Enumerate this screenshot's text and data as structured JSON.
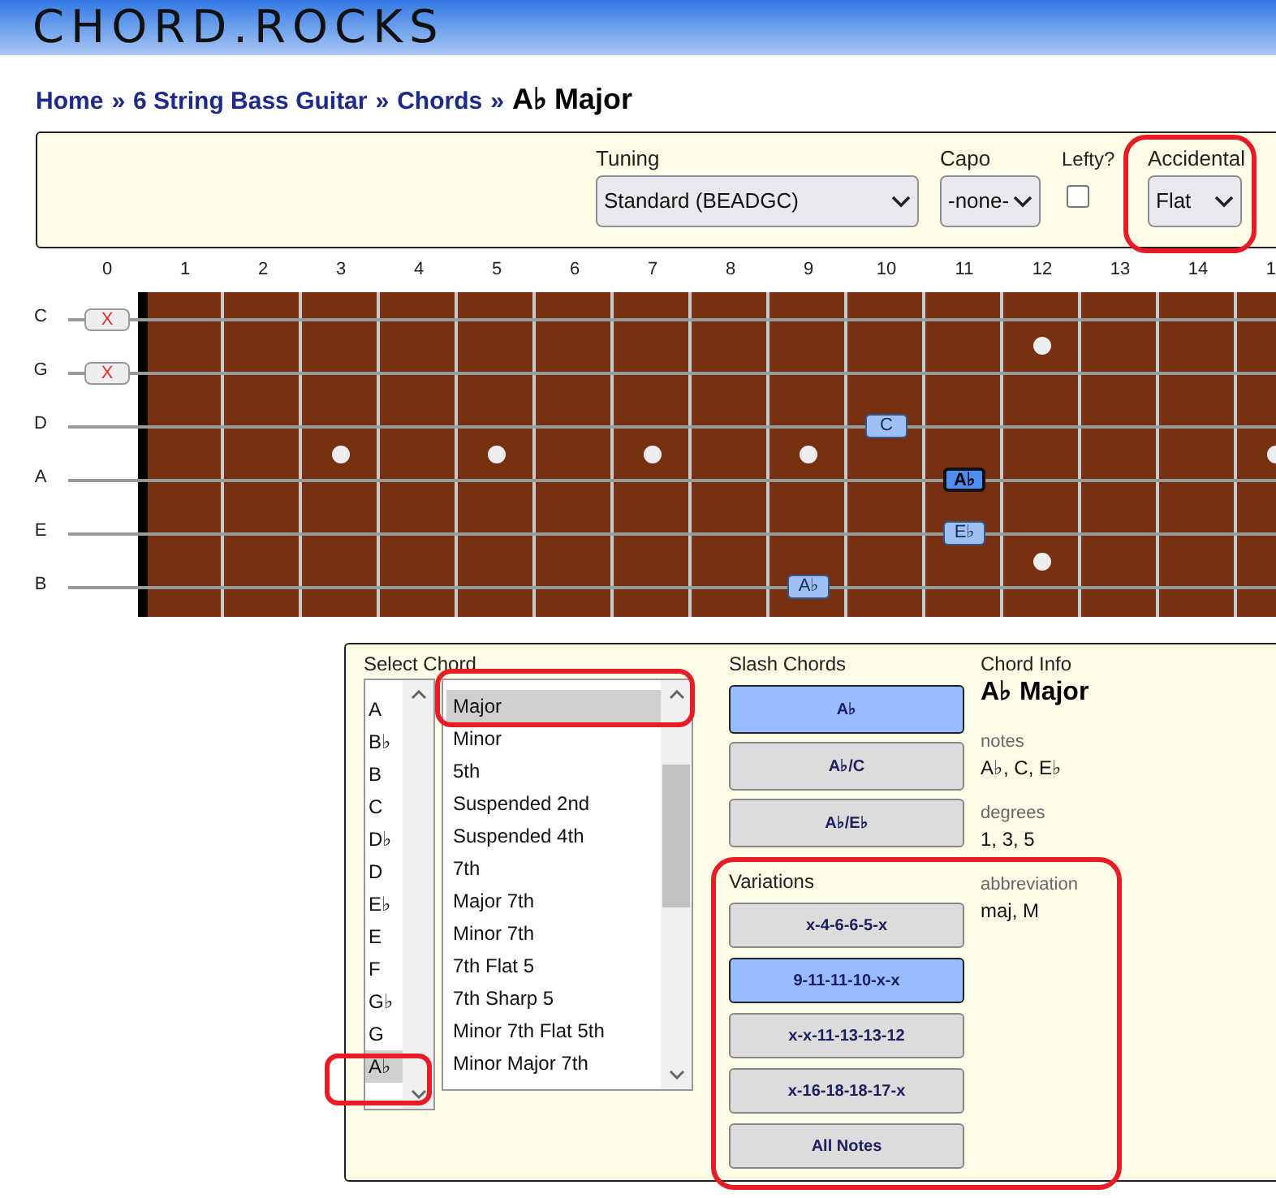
{
  "header": {
    "logo": "CHORD.ROCKS"
  },
  "breadcrumb": [
    {
      "kind": "link",
      "text": "Home"
    },
    {
      "kind": "separator",
      "text": "»"
    },
    {
      "kind": "link",
      "text": "6 String Bass Guitar"
    },
    {
      "kind": "separator",
      "text": "»"
    },
    {
      "kind": "link",
      "text": "Chords"
    },
    {
      "kind": "separator",
      "text": "»"
    },
    {
      "kind": "current",
      "text": "A♭ Major"
    }
  ],
  "settings": {
    "tuning": {
      "label": "Tuning",
      "value": "Standard (BEADGC)"
    },
    "capo": {
      "label": "Capo",
      "value": "-none-"
    },
    "lefty": {
      "label": "Lefty?",
      "checked": false
    },
    "accidental": {
      "label": "Accidental",
      "value": "Flat"
    }
  },
  "fretboard": {
    "fret_numbers": [
      "0",
      "1",
      "2",
      "3",
      "4",
      "5",
      "6",
      "7",
      "8",
      "9",
      "10",
      "11",
      "12",
      "13",
      "14",
      "1"
    ],
    "strings": [
      {
        "name": "C",
        "frets": [
          {
            "kind": "muted",
            "label": "X"
          },
          {
            "kind": "empty"
          },
          {
            "kind": "empty"
          },
          {
            "kind": "empty"
          },
          {
            "kind": "empty"
          },
          {
            "kind": "empty"
          },
          {
            "kind": "empty"
          },
          {
            "kind": "empty"
          },
          {
            "kind": "empty"
          },
          {
            "kind": "empty"
          },
          {
            "kind": "empty"
          },
          {
            "kind": "empty"
          },
          {
            "kind": "empty"
          },
          {
            "kind": "empty"
          },
          {
            "kind": "empty"
          }
        ]
      },
      {
        "name": "G",
        "frets": [
          {
            "kind": "muted",
            "label": "X"
          },
          {
            "kind": "empty"
          },
          {
            "kind": "empty"
          },
          {
            "kind": "empty"
          },
          {
            "kind": "empty"
          },
          {
            "kind": "empty"
          },
          {
            "kind": "empty"
          },
          {
            "kind": "empty"
          },
          {
            "kind": "empty"
          },
          {
            "kind": "empty"
          },
          {
            "kind": "empty"
          },
          {
            "kind": "empty"
          },
          {
            "kind": "empty"
          },
          {
            "kind": "empty"
          },
          {
            "kind": "empty"
          }
        ]
      },
      {
        "name": "D",
        "frets": [
          {
            "kind": "empty"
          },
          {
            "kind": "empty"
          },
          {
            "kind": "empty"
          },
          {
            "kind": "empty"
          },
          {
            "kind": "empty"
          },
          {
            "kind": "empty"
          },
          {
            "kind": "empty"
          },
          {
            "kind": "empty"
          },
          {
            "kind": "empty"
          },
          {
            "kind": "empty"
          },
          {
            "kind": "note",
            "label": "C",
            "root": false
          },
          {
            "kind": "empty"
          },
          {
            "kind": "empty"
          },
          {
            "kind": "empty"
          },
          {
            "kind": "empty"
          }
        ]
      },
      {
        "name": "A",
        "frets": [
          {
            "kind": "empty"
          },
          {
            "kind": "empty"
          },
          {
            "kind": "empty"
          },
          {
            "kind": "empty"
          },
          {
            "kind": "empty"
          },
          {
            "kind": "empty"
          },
          {
            "kind": "empty"
          },
          {
            "kind": "empty"
          },
          {
            "kind": "empty"
          },
          {
            "kind": "empty"
          },
          {
            "kind": "empty"
          },
          {
            "kind": "note",
            "label": "A♭",
            "root": true
          },
          {
            "kind": "empty"
          },
          {
            "kind": "empty"
          },
          {
            "kind": "empty"
          }
        ]
      },
      {
        "name": "E",
        "frets": [
          {
            "kind": "empty"
          },
          {
            "kind": "empty"
          },
          {
            "kind": "empty"
          },
          {
            "kind": "empty"
          },
          {
            "kind": "empty"
          },
          {
            "kind": "empty"
          },
          {
            "kind": "empty"
          },
          {
            "kind": "empty"
          },
          {
            "kind": "empty"
          },
          {
            "kind": "empty"
          },
          {
            "kind": "empty"
          },
          {
            "kind": "note",
            "label": "E♭",
            "root": false
          },
          {
            "kind": "empty"
          },
          {
            "kind": "empty"
          },
          {
            "kind": "empty"
          }
        ]
      },
      {
        "name": "B",
        "frets": [
          {
            "kind": "empty"
          },
          {
            "kind": "empty"
          },
          {
            "kind": "empty"
          },
          {
            "kind": "empty"
          },
          {
            "kind": "empty"
          },
          {
            "kind": "empty"
          },
          {
            "kind": "empty"
          },
          {
            "kind": "empty"
          },
          {
            "kind": "empty"
          },
          {
            "kind": "note",
            "label": "A♭",
            "root": false
          },
          {
            "kind": "empty"
          },
          {
            "kind": "empty"
          },
          {
            "kind": "empty"
          },
          {
            "kind": "empty"
          },
          {
            "kind": "empty"
          }
        ]
      }
    ]
  },
  "chord_select": {
    "label": "Select Chord",
    "roots": [
      {
        "label": "A",
        "selected": false
      },
      {
        "label": "B♭",
        "selected": false
      },
      {
        "label": "B",
        "selected": false
      },
      {
        "label": "C",
        "selected": false
      },
      {
        "label": "D♭",
        "selected": false
      },
      {
        "label": "D",
        "selected": false
      },
      {
        "label": "E♭",
        "selected": false
      },
      {
        "label": "E",
        "selected": false
      },
      {
        "label": "F",
        "selected": false
      },
      {
        "label": "G♭",
        "selected": false
      },
      {
        "label": "G",
        "selected": false
      },
      {
        "label": "A♭",
        "selected": true
      }
    ],
    "qualities": [
      {
        "label": "Major",
        "selected": true
      },
      {
        "label": "Minor",
        "selected": false
      },
      {
        "label": "5th",
        "selected": false
      },
      {
        "label": "Suspended 2nd",
        "selected": false
      },
      {
        "label": "Suspended 4th",
        "selected": false
      },
      {
        "label": "7th",
        "selected": false
      },
      {
        "label": "Major 7th",
        "selected": false
      },
      {
        "label": "Minor 7th",
        "selected": false
      },
      {
        "label": "7th Flat 5",
        "selected": false
      },
      {
        "label": "7th Sharp 5",
        "selected": false
      },
      {
        "label": "Minor 7th Flat 5th",
        "selected": false
      },
      {
        "label": "Minor Major 7th",
        "selected": false
      }
    ]
  },
  "slash_chords": {
    "title": "Slash Chords",
    "items": [
      {
        "label": "A♭",
        "selected": true
      },
      {
        "label": "A♭/C",
        "selected": false
      },
      {
        "label": "A♭/E♭",
        "selected": false
      }
    ]
  },
  "variations": {
    "title": "Variations",
    "items": [
      {
        "label": "x-4-6-6-5-x",
        "selected": false
      },
      {
        "label": "9-11-11-10-x-x",
        "selected": true
      },
      {
        "label": "x-x-11-13-13-12",
        "selected": false
      },
      {
        "label": "x-16-18-18-17-x",
        "selected": false
      },
      {
        "label": "All Notes",
        "selected": false
      }
    ]
  },
  "chord_info": {
    "title": "Chord Info",
    "name": "A♭ Major",
    "fields": [
      {
        "label": "notes",
        "value": "A♭, C, E♭"
      },
      {
        "label": "degrees",
        "value": "1, 3, 5"
      },
      {
        "label": "abbreviation",
        "value": "maj, M"
      }
    ]
  }
}
